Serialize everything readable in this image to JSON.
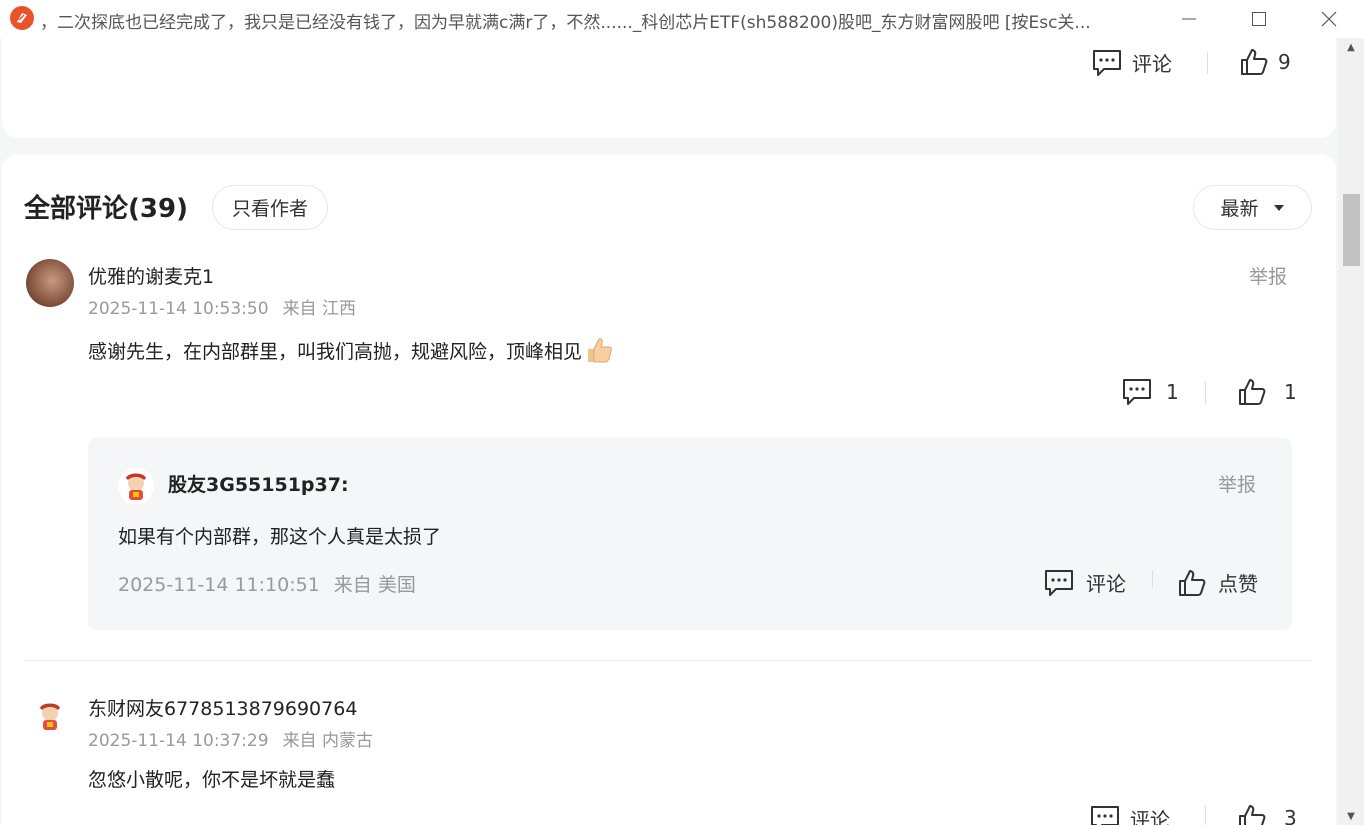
{
  "window": {
    "title": "，二次探底也已经完成了，我只是已经没有钱了，因为早就满c满r了，不然......_科创芯片ETF(sh588200)股吧_东方财富网股吧    [按Esc关..."
  },
  "previous_post": {
    "comment_label": "评论",
    "like_count": "9"
  },
  "comments_section": {
    "title": "全部评论(39)",
    "author_only_label": "只看作者",
    "sort_label": "最新"
  },
  "comments": [
    {
      "username": "优雅的谢麦克1",
      "time": "2025-11-14 10:53:50",
      "location": "来自 江西",
      "report_label": "举报",
      "content": "感谢先生，在内部群里，叫我们高抛，规避风险，顶峰相见",
      "comment_count": "1",
      "like_count": "1",
      "reply": {
        "username": "股友3G55151p37:",
        "report_label": "举报",
        "content": "如果有个内部群，那这个人真是太损了",
        "time": "2025-11-14 11:10:51",
        "location": "来自 美国",
        "comment_label": "评论",
        "like_label": "点赞"
      }
    },
    {
      "username": "东财网友6778513879690764",
      "time": "2025-11-14 10:37:29",
      "location": "来自 内蒙古",
      "content": "忽悠小散呢，你不是坏就是蠢",
      "comment_label": "评论",
      "like_count": "3"
    }
  ]
}
